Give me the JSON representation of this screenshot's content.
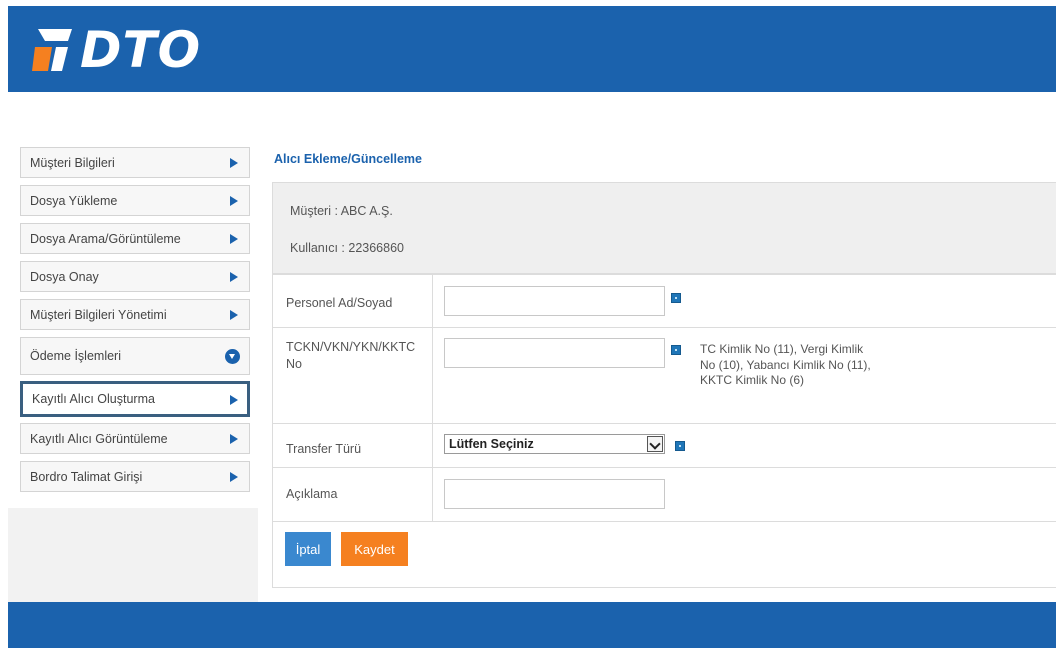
{
  "brand": {
    "logo_text": "DTO",
    "header_color": "#1b62ad",
    "accent_orange": "#f58020"
  },
  "sidebar": {
    "items": [
      {
        "label": "Müşteri Bilgileri",
        "icon": "arrow-right-icon"
      },
      {
        "label": "Dosya Yükleme",
        "icon": "arrow-right-icon"
      },
      {
        "label": "Dosya Arama/Görüntüleme",
        "icon": "arrow-right-icon"
      },
      {
        "label": "Dosya Onay",
        "icon": "arrow-right-icon"
      },
      {
        "label": "Müşteri Bilgileri Yönetimi",
        "icon": "arrow-right-icon"
      },
      {
        "label": "Ödeme İşlemleri",
        "icon": "chevron-down-circle-icon"
      },
      {
        "label": "Kayıtlı Alıcı Oluşturma",
        "icon": "arrow-right-icon",
        "selected": true
      },
      {
        "label": "Kayıtlı Alıcı Görüntüleme",
        "icon": "arrow-right-icon"
      },
      {
        "label": "Bordro Talimat Girişi",
        "icon": "arrow-right-icon"
      }
    ]
  },
  "main": {
    "title": "Alıcı Ekleme/Güncelleme",
    "customer_line": "Müşteri :  ABC A.Ş.",
    "user_line": "Kullanıcı : 22366860",
    "form": {
      "personel_label": "Personel Ad/Soyad",
      "personel_value": "",
      "tckn_label": "TCKN/VKN/YKN/KKTC No",
      "tckn_value": "",
      "tckn_hint": "TC Kimlik No (11), Vergi Kimlik No (10), Yabancı Kimlik No (11), KKTC Kimlik No (6)",
      "transfer_label": "Transfer Türü",
      "transfer_selected": "Lütfen Seçiniz",
      "aciklama_label": "Açıklama",
      "aciklama_value": ""
    },
    "buttons": {
      "cancel": "İptal",
      "save": "Kaydet"
    }
  }
}
